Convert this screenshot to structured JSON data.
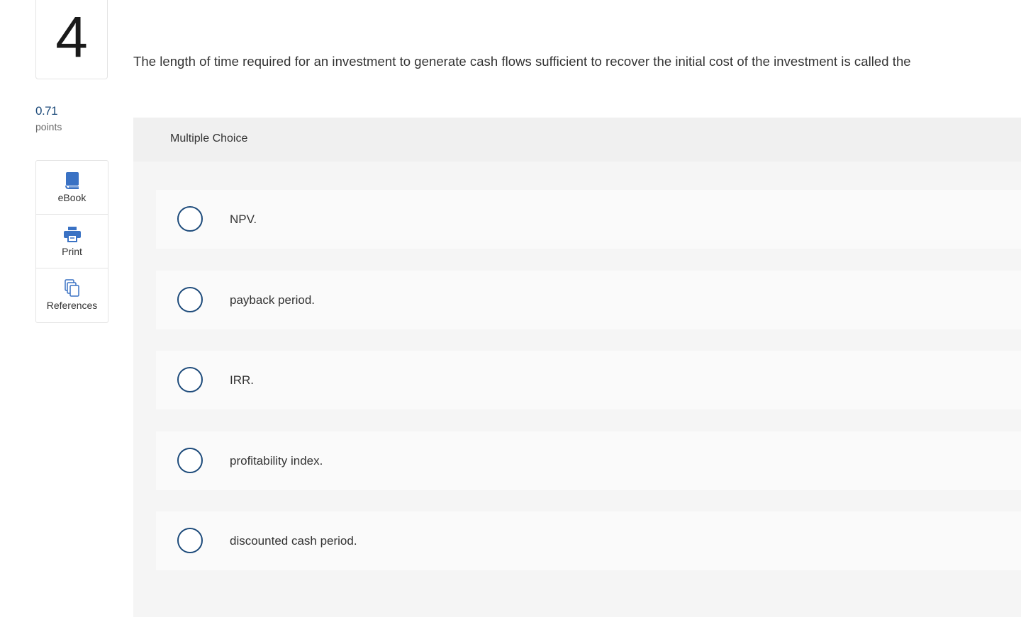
{
  "question": {
    "number": "4",
    "points_value": "0.71",
    "points_label": "points",
    "prompt": "The length of time required for an investment to generate cash flows sufficient to recover the initial cost of the investment is called the"
  },
  "tools": [
    {
      "label": "eBook",
      "icon": "book-icon"
    },
    {
      "label": "Print",
      "icon": "printer-icon"
    },
    {
      "label": "References",
      "icon": "copy-icon"
    }
  ],
  "multiple_choice": {
    "header": "Multiple Choice",
    "options": [
      {
        "label": "NPV."
      },
      {
        "label": "payback period."
      },
      {
        "label": "IRR."
      },
      {
        "label": "profitability index."
      },
      {
        "label": "discounted cash period."
      }
    ]
  },
  "colors": {
    "accent": "#1c4a7a",
    "icon_blue": "#3a72c4",
    "header_bg": "#f0f0f0",
    "body_bg": "#f5f5f5",
    "option_bg": "#fafafa"
  }
}
